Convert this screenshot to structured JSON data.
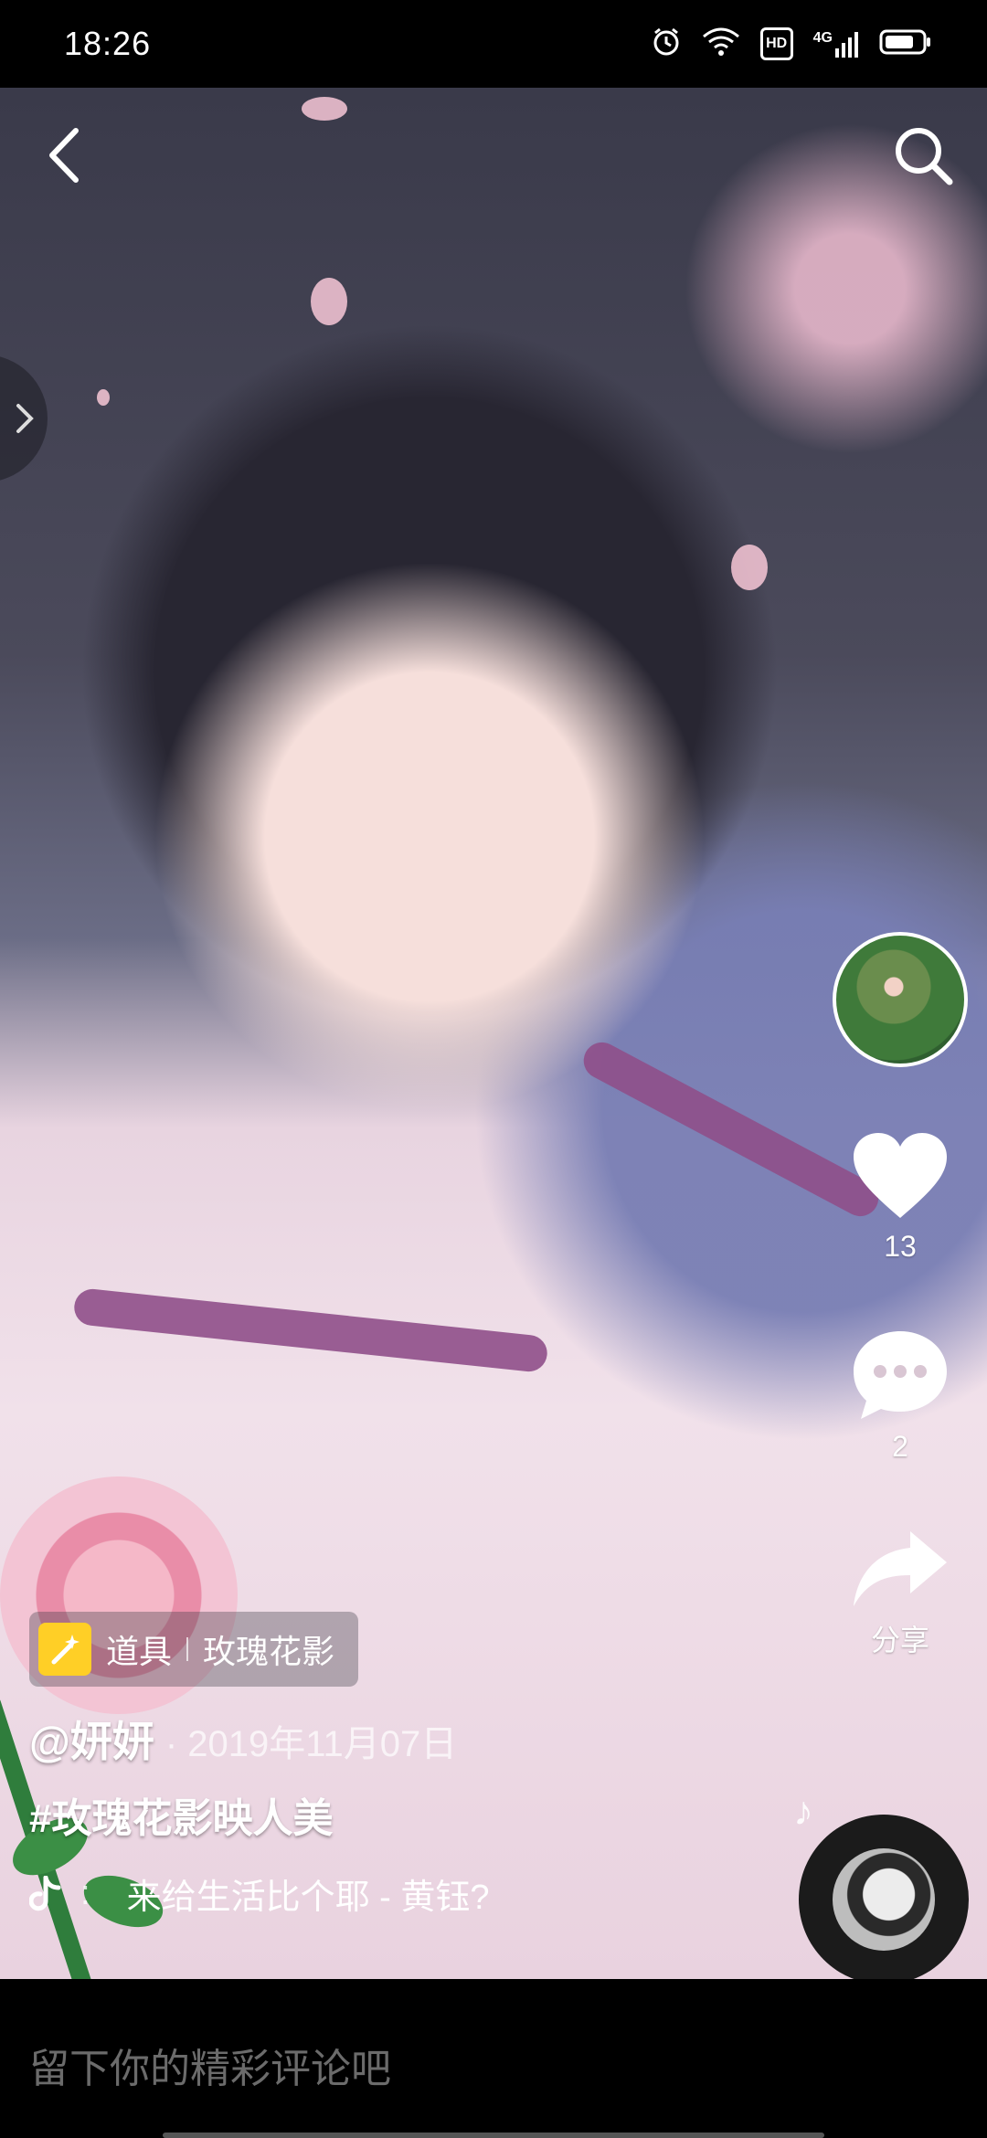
{
  "status_bar": {
    "time": "18:26",
    "hd_label": "HD",
    "network_label": "4G"
  },
  "video": {
    "prop_label": "道具",
    "prop_name": "玫瑰花影",
    "username": "@妍妍",
    "date": "· 2019年11月07日",
    "hashtag": "#玫瑰花影映人美",
    "music_title": "来给生活比个耶 - 黄钰?"
  },
  "actions": {
    "likes": "13",
    "comments": "2",
    "share_label": "分享"
  },
  "comment_bar": {
    "placeholder": "留下你的精彩评论吧"
  }
}
